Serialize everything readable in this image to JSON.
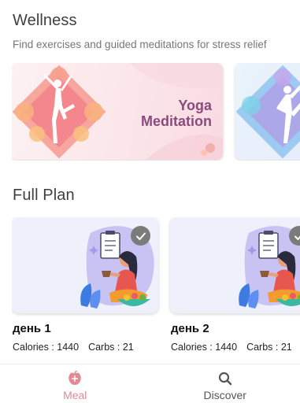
{
  "wellness": {
    "title": "Wellness",
    "subtitle": "Find exercises and guided meditations for stress relief",
    "banners": [
      {
        "line1": "Yoga",
        "line2": "Meditation"
      }
    ]
  },
  "full_plan": {
    "title": "Full Plan",
    "cards": [
      {
        "name": "день 1",
        "calories": "Calories : 1440",
        "carbs": "Carbs : 21"
      },
      {
        "name": "день 2",
        "calories": "Calories : 1440",
        "carbs": "Carbs : 21"
      }
    ]
  },
  "nav": {
    "items": [
      {
        "label": "Meal",
        "icon": "meal-icon",
        "active": true
      },
      {
        "label": "Discover",
        "icon": "search-icon",
        "active": false
      }
    ]
  },
  "colors": {
    "accent": "#e08a97",
    "yoga_title": "#8b4a7e"
  }
}
